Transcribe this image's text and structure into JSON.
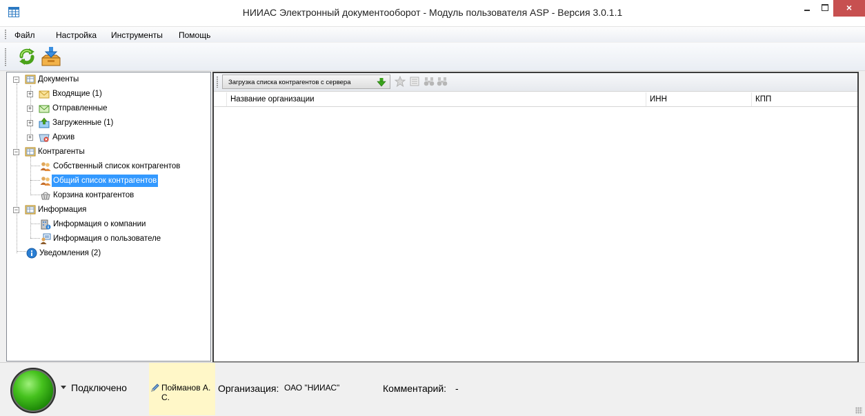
{
  "window": {
    "title": "НИИАС Электронный документооборот - Модуль пользователя ASP - Версия 3.0.1.1",
    "close_glyph": "×"
  },
  "menu": {
    "items": [
      "Файл",
      "Настройка",
      "Инструменты",
      "Помощь"
    ]
  },
  "toolbar": {
    "buttons": [
      "refresh-icon",
      "download-icon"
    ]
  },
  "tree": {
    "nodes": [
      {
        "label": "Документы",
        "icon": "folder-grid-icon"
      },
      {
        "label": "Входящие (1)",
        "icon": "envelope-open-icon"
      },
      {
        "label": "Отправленные",
        "icon": "envelope-sent-icon"
      },
      {
        "label": "Загруженные (1)",
        "icon": "upload-folder-icon"
      },
      {
        "label": "Архив",
        "icon": "archive-icon"
      },
      {
        "label": "Контрагенты",
        "icon": "folder-grid-icon"
      },
      {
        "label": "Собственный список контрагентов",
        "icon": "users-icon"
      },
      {
        "label": "Общий список контрагентов",
        "icon": "users-icon",
        "selected": true
      },
      {
        "label": "Корзина контрагентов",
        "icon": "basket-icon"
      },
      {
        "label": "Информация",
        "icon": "folder-grid-icon"
      },
      {
        "label": "Информация о компании",
        "icon": "company-info-icon"
      },
      {
        "label": "Информация о пользователе",
        "icon": "user-info-icon"
      },
      {
        "label": "Уведомления (2)",
        "icon": "info-circle-icon"
      }
    ]
  },
  "panel": {
    "load_button": "Загрузка списка контрагентов с сервера",
    "columns": [
      "Название организации",
      "ИНН",
      "КПП"
    ]
  },
  "status": {
    "connection": "Подключено",
    "user": "Пойманов А. С.",
    "org_label": "Организация:",
    "org_value": "ОАО \"НИИАС\"",
    "comment_label": "Комментарий:",
    "comment_value": "-"
  },
  "colors": {
    "selection": "#3399ff",
    "close_button": "#c75050",
    "user_highlight": "#fff7c8",
    "status_led": "#46c21e"
  }
}
